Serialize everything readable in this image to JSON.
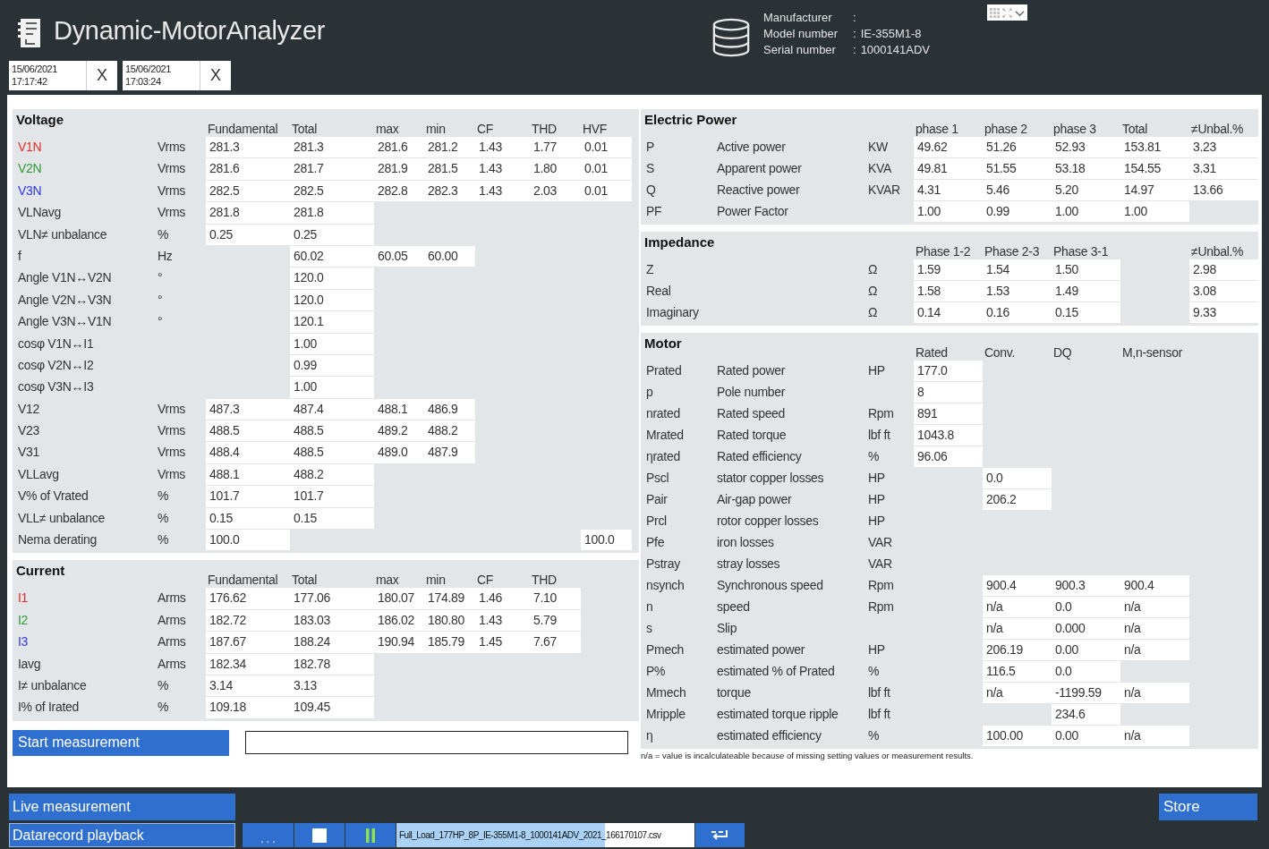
{
  "app": {
    "title": "Dynamic-MotorAnalyzer"
  },
  "time_filters": [
    {
      "date": "15/06/2021",
      "time": "17:17:42",
      "clear": "X"
    },
    {
      "date": "15/06/2021",
      "time": "17:03:24",
      "clear": "X"
    }
  ],
  "device_info": [
    {
      "label": "Manufacturer",
      "separator": ":"
    },
    {
      "label": "Model number",
      "separator": ":",
      "value": "IE-355M1-8"
    },
    {
      "label": "Serial number",
      "separator": ":",
      "value": "1000141ADV"
    }
  ],
  "left_sections": [
    {
      "title": "Voltage",
      "columns": [
        "Fundamental",
        "Total",
        "max",
        "min",
        "CF",
        "THD",
        "HVF"
      ],
      "rows": [
        {
          "label": "V1N",
          "color": "#e52b2b",
          "unit": "Vrms",
          "cells": [
            "281.3",
            "281.3",
            "281.6",
            "281.2",
            "1.43",
            "1.77",
            "0.01"
          ]
        },
        {
          "label": "V2N",
          "color": "#2e9a34",
          "unit": "Vrms",
          "cells": [
            "281.6",
            "281.7",
            "281.9",
            "281.5",
            "1.43",
            "1.80",
            "0.01"
          ]
        },
        {
          "label": "V3N",
          "color": "#2f35de",
          "unit": "Vrms",
          "cells": [
            "282.5",
            "282.5",
            "282.8",
            "282.3",
            "1.43",
            "2.03",
            "0.01"
          ]
        },
        {
          "label": "VLNavg",
          "unit": "Vrms",
          "cells": [
            "281.8",
            "281.8"
          ]
        },
        {
          "label": "VLN≠ unbalance",
          "unit": "%",
          "cells": [
            "0.25",
            "0.25"
          ]
        },
        {
          "label": "f",
          "unit": "Hz",
          "cells": [
            null,
            "60.02",
            "60.05",
            "60.00"
          ]
        },
        {
          "label": "Angle V1N↔V2N",
          "unit": "°",
          "cells": [
            null,
            "120.0"
          ]
        },
        {
          "label": "Angle V2N↔V3N",
          "unit": "°",
          "cells": [
            null,
            "120.0"
          ]
        },
        {
          "label": "Angle V3N↔V1N",
          "unit": "°",
          "cells": [
            null,
            "120.1"
          ]
        },
        {
          "label": "cosφ V1N↔I1",
          "cells": [
            null,
            "1.00"
          ]
        },
        {
          "label": "cosφ V2N↔I2",
          "cells": [
            null,
            "0.99"
          ]
        },
        {
          "label": "cosφ V3N↔I3",
          "cells": [
            null,
            "1.00"
          ]
        },
        {
          "label": "V12",
          "unit": "Vrms",
          "cells": [
            "487.3",
            "487.4",
            "488.1",
            "486.9"
          ]
        },
        {
          "label": "V23",
          "unit": "Vrms",
          "cells": [
            "488.5",
            "488.5",
            "489.2",
            "488.2"
          ]
        },
        {
          "label": "V31",
          "unit": "Vrms",
          "cells": [
            "488.4",
            "488.5",
            "489.0",
            "487.9"
          ]
        },
        {
          "label": "VLLavg",
          "unit": "Vrms",
          "cells": [
            "488.1",
            "488.2"
          ]
        },
        {
          "label": "V% of Vrated",
          "unit": "%",
          "cells": [
            "101.7",
            "101.7"
          ]
        },
        {
          "label": "VLL≠ unbalance",
          "unit": "%",
          "cells": [
            "0.15",
            "0.15"
          ]
        },
        {
          "label": "Nema derating",
          "unit": "%",
          "cells": [
            "100.0",
            null,
            null,
            null,
            null,
            null,
            "100.0"
          ]
        }
      ]
    },
    {
      "title": "Current",
      "columns": [
        "Fundamental",
        "Total",
        "max",
        "min",
        "CF",
        "THD"
      ],
      "rows": [
        {
          "label": "I1",
          "color": "#e52b2b",
          "unit": "Arms",
          "cells": [
            "176.62",
            "177.06",
            "180.07",
            "174.89",
            "1.46",
            "7.10"
          ]
        },
        {
          "label": "I2",
          "color": "#2e9a34",
          "unit": "Arms",
          "cells": [
            "182.72",
            "183.03",
            "186.02",
            "180.80",
            "1.43",
            "5.79"
          ]
        },
        {
          "label": "I3",
          "color": "#2f35de",
          "unit": "Arms",
          "cells": [
            "187.67",
            "188.24",
            "190.94",
            "185.79",
            "1.45",
            "7.67"
          ]
        },
        {
          "label": "Iavg",
          "unit": "Arms",
          "cells": [
            "182.34",
            "182.78"
          ]
        },
        {
          "label": "I≠ unbalance",
          "unit": "%",
          "cells": [
            "3.14",
            "3.13"
          ]
        },
        {
          "label": "I% of Irated",
          "unit": "%",
          "cells": [
            "109.18",
            "109.45"
          ]
        }
      ]
    }
  ],
  "start_button": "Start measurement",
  "right_sections": [
    {
      "title": "Electric Power",
      "columns": [
        "phase 1",
        "phase 2",
        "phase 3",
        "Total",
        "≠Unbal.%"
      ],
      "rows": [
        {
          "label": "P",
          "description": "Active power",
          "unit": "KW",
          "cells": [
            "49.62",
            "51.26",
            "52.93",
            "153.81",
            "3.23"
          ]
        },
        {
          "label": "S",
          "description": "Apparent power",
          "unit": "KVA",
          "cells": [
            "49.81",
            "51.55",
            "53.18",
            "154.55",
            "3.31"
          ]
        },
        {
          "label": "Q",
          "description": "Reactive power",
          "unit": "KVAR",
          "cells": [
            "4.31",
            "5.46",
            "5.20",
            "14.97",
            "13.66"
          ]
        },
        {
          "label": "PF",
          "description": "Power Factor",
          "cells": [
            "1.00",
            "0.99",
            "1.00",
            "1.00",
            null
          ]
        }
      ]
    },
    {
      "title": "Impedance",
      "columns": [
        "Phase 1-2",
        "Phase 2-3",
        "Phase 3-1",
        null,
        "≠Unbal.%"
      ],
      "rows": [
        {
          "label": "Z",
          "unit": "Ω",
          "cells": [
            "1.59",
            "1.54",
            "1.50",
            null,
            "2.98"
          ]
        },
        {
          "label": "Real",
          "unit": "Ω",
          "cells": [
            "1.58",
            "1.53",
            "1.49",
            null,
            "3.08"
          ]
        },
        {
          "label": "Imaginary",
          "unit": "Ω",
          "cells": [
            "0.14",
            "0.16",
            "0.15",
            null,
            "9.33"
          ]
        }
      ]
    },
    {
      "title": "Motor",
      "columns": [
        "Rated",
        "Conv.",
        "DQ",
        "M,n-sensor"
      ],
      "rows": [
        {
          "label": "Prated",
          "description": "Rated power",
          "unit": "HP",
          "cells": [
            "177.0"
          ]
        },
        {
          "label": "p",
          "description": "Pole number",
          "cells": [
            "8"
          ]
        },
        {
          "label": "nrated",
          "description": "Rated speed",
          "unit": "Rpm",
          "cells": [
            "891"
          ]
        },
        {
          "label": "Mrated",
          "description": "Rated torque",
          "unit": "lbf ft",
          "cells": [
            "1043.8"
          ]
        },
        {
          "label": "ηrated",
          "description": "Rated efficiency",
          "unit": "%",
          "cells": [
            "96.06"
          ]
        },
        {
          "label": "Pscl",
          "description": "stator copper losses",
          "unit": "HP",
          "cells": [
            null,
            "0.0"
          ]
        },
        {
          "label": "Pair",
          "description": "Air-gap power",
          "unit": "HP",
          "cells": [
            null,
            "206.2"
          ]
        },
        {
          "label": "Prcl",
          "description": "rotor copper losses",
          "unit": "HP",
          "cells": []
        },
        {
          "label": "Pfe",
          "description": "iron losses",
          "unit": "VAR",
          "cells": []
        },
        {
          "label": "Pstray",
          "description": "stray losses",
          "unit": "VAR",
          "cells": []
        },
        {
          "label": "nsynch",
          "description": "Synchronous speed",
          "unit": "Rpm",
          "cells": [
            null,
            "900.4",
            "900.3",
            "900.4"
          ]
        },
        {
          "label": "n",
          "description": "speed",
          "unit": "Rpm",
          "cells": [
            null,
            "n/a",
            "0.0",
            "n/a"
          ]
        },
        {
          "label": "s",
          "description": "Slip",
          "cells": [
            null,
            "n/a",
            "0.000",
            "n/a"
          ]
        },
        {
          "label": "Pmech",
          "description": "estimated power",
          "unit": "HP",
          "cells": [
            null,
            "206.19",
            "0.00",
            "n/a"
          ]
        },
        {
          "label": "P%",
          "description": "estimated % of Prated",
          "unit": "%",
          "cells": [
            null,
            "116.5",
            "0.0"
          ]
        },
        {
          "label": "Mmech",
          "description": "torque",
          "unit": "lbf ft",
          "cells": [
            null,
            "n/a",
            "-1199.59",
            "n/a"
          ]
        },
        {
          "label": "Mripple",
          "description": "estimated torque ripple",
          "unit": "lbf ft",
          "cells": [
            null,
            null,
            "234.6"
          ]
        },
        {
          "label": "η",
          "description": "estimated efficiency",
          "unit": "%",
          "cells": [
            null,
            "100.00",
            "0.00",
            "n/a"
          ]
        }
      ]
    }
  ],
  "footnote": "n/a = value is incalculateable because of missing setting values or measurement results.",
  "modes": [
    {
      "label": "Live measurement",
      "selected": false
    },
    {
      "label": "Datarecord playback",
      "selected": true
    }
  ],
  "playback": {
    "browse": ". . .",
    "file": "Full_Load_177HP_8P_IE-355M1-8_1000141ADV_2021_166170107.csv"
  },
  "store_button": "Store"
}
